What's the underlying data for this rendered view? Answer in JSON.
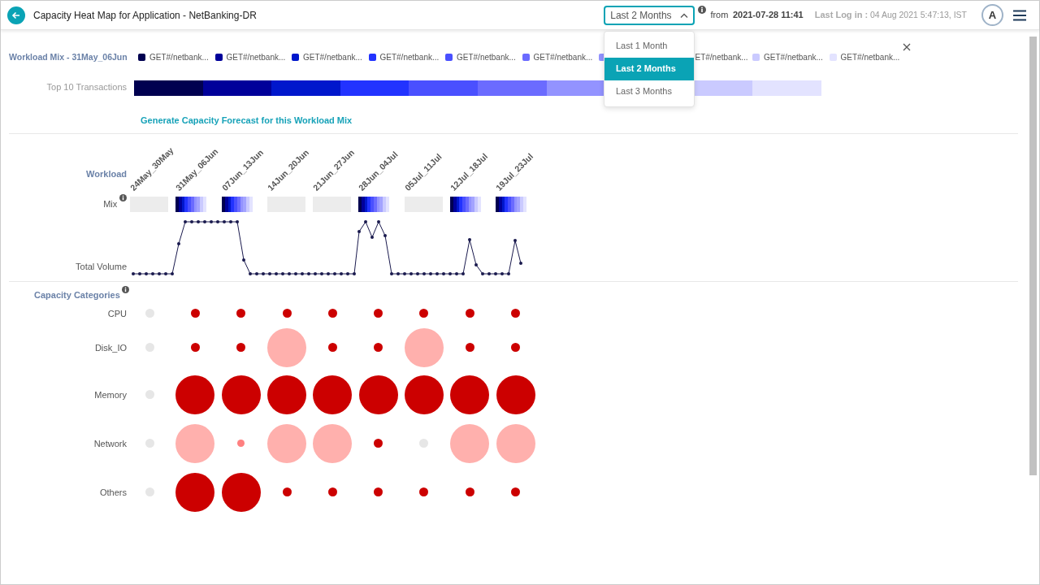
{
  "header": {
    "title": "Capacity Heat Map for Application - NetBanking-DR",
    "period_select": {
      "value": "Last 2 Months",
      "expanded": true,
      "options": [
        {
          "label": "Last 1 Month",
          "selected": false
        },
        {
          "label": "Last 2 Months",
          "selected": true
        },
        {
          "label": "Last 3 Months",
          "selected": false
        }
      ]
    },
    "from_label": "from",
    "from_value": "2021-07-28 11:41",
    "last_login_label": "Last Log in :",
    "last_login_value": "04 Aug 2021 5:47:13, IST",
    "avatar": "A"
  },
  "workload_mix": {
    "title": "Workload Mix - 31May_06Jun",
    "bar_label": "Top 10 Transactions",
    "legend": [
      {
        "label": "GET#/netbank...",
        "color": "#000050"
      },
      {
        "label": "GET#/netbank...",
        "color": "#00009a"
      },
      {
        "label": "GET#/netbank...",
        "color": "#0017cc"
      },
      {
        "label": "GET#/netbank...",
        "color": "#2233ff"
      },
      {
        "label": "GET#/netbank...",
        "color": "#4a50ff"
      },
      {
        "label": "GET#/netbank...",
        "color": "#6b6bff"
      },
      {
        "color": "#9393ff"
      },
      {
        "label": "ET#/netbank..."
      },
      {
        "label": "GET#/netbank...",
        "color": "#cacaff"
      },
      {
        "label": "GET#/netbank...",
        "color": "#e3e3ff"
      }
    ],
    "forecast_link": "Generate Capacity Forecast for this Workload Mix"
  },
  "workload": {
    "label": "Workload",
    "mix_label": "Mix",
    "volume_label": "Total Volume",
    "weeks": [
      {
        "label": "24May_30May",
        "has_mix": false
      },
      {
        "label": "31May_06Jun",
        "has_mix": true
      },
      {
        "label": "07Jun_13Jun",
        "has_mix": true
      },
      {
        "label": "14Jun_20Jun",
        "has_mix": false
      },
      {
        "label": "21Jun_27Jun",
        "has_mix": false
      },
      {
        "label": "28Jun_04Jul",
        "has_mix": true
      },
      {
        "label": "05Jul_11Jul",
        "has_mix": false
      },
      {
        "label": "12Jul_18Jul",
        "has_mix": true
      },
      {
        "label": "19Jul_23Jul",
        "has_mix": true
      }
    ]
  },
  "capacity": {
    "title": "Capacity Categories",
    "rows": [
      {
        "label": "CPU",
        "cells": [
          {
            "kind": "small",
            "color": "#e6e6e6"
          },
          {
            "kind": "small",
            "color": "#cc0000"
          },
          {
            "kind": "small",
            "color": "#cc0000"
          },
          {
            "kind": "small",
            "color": "#cc0000"
          },
          {
            "kind": "small",
            "color": "#cc0000"
          },
          {
            "kind": "small",
            "color": "#cc0000"
          },
          {
            "kind": "small",
            "color": "#cc0000"
          },
          {
            "kind": "small",
            "color": "#cc0000"
          },
          {
            "kind": "small",
            "color": "#cc0000"
          }
        ]
      },
      {
        "label": "Disk_IO",
        "cells": [
          {
            "kind": "small",
            "color": "#e6e6e6"
          },
          {
            "kind": "small",
            "color": "#cc0000"
          },
          {
            "kind": "small",
            "color": "#cc0000"
          },
          {
            "kind": "large",
            "color": "#ffb0ad"
          },
          {
            "kind": "small",
            "color": "#cc0000"
          },
          {
            "kind": "small",
            "color": "#cc0000"
          },
          {
            "kind": "large",
            "color": "#ffb0ad"
          },
          {
            "kind": "small",
            "color": "#cc0000"
          },
          {
            "kind": "small",
            "color": "#cc0000"
          }
        ]
      },
      {
        "label": "Memory",
        "cells": [
          {
            "kind": "small",
            "color": "#e6e6e6"
          },
          {
            "kind": "large",
            "color": "#cc0000"
          },
          {
            "kind": "large",
            "color": "#cc0000"
          },
          {
            "kind": "large",
            "color": "#cc0000"
          },
          {
            "kind": "large",
            "color": "#cc0000"
          },
          {
            "kind": "large",
            "color": "#cc0000"
          },
          {
            "kind": "large",
            "color": "#cc0000"
          },
          {
            "kind": "large",
            "color": "#cc0000"
          },
          {
            "kind": "large",
            "color": "#cc0000"
          }
        ]
      },
      {
        "label": "Network",
        "cells": [
          {
            "kind": "small",
            "color": "#e6e6e6"
          },
          {
            "kind": "large",
            "color": "#ffb0ad"
          },
          {
            "kind": "tiny",
            "color": "#ff8080"
          },
          {
            "kind": "large",
            "color": "#ffb0ad"
          },
          {
            "kind": "large",
            "color": "#ffb0ad"
          },
          {
            "kind": "small",
            "color": "#cc0000"
          },
          {
            "kind": "small",
            "color": "#e6e6e6"
          },
          {
            "kind": "large",
            "color": "#ffb0ad"
          },
          {
            "kind": "large",
            "color": "#ffb0ad"
          }
        ]
      },
      {
        "label": "Others",
        "cells": [
          {
            "kind": "small",
            "color": "#e6e6e6"
          },
          {
            "kind": "large",
            "color": "#cc0000"
          },
          {
            "kind": "large",
            "color": "#cc0000"
          },
          {
            "kind": "small",
            "color": "#cc0000"
          },
          {
            "kind": "small",
            "color": "#cc0000"
          },
          {
            "kind": "small",
            "color": "#cc0000"
          },
          {
            "kind": "small",
            "color": "#cc0000"
          },
          {
            "kind": "small",
            "color": "#cc0000"
          },
          {
            "kind": "small",
            "color": "#cc0000"
          }
        ]
      }
    ]
  }
}
